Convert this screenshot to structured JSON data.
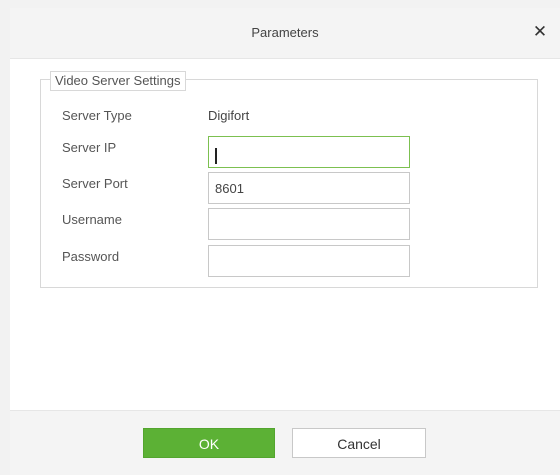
{
  "dialog": {
    "title": "Parameters",
    "close_glyph": "✕"
  },
  "fieldset": {
    "legend": "Video Server Settings"
  },
  "fields": {
    "server_type": {
      "label": "Server Type",
      "value": "Digifort"
    },
    "server_ip": {
      "label": "Server IP",
      "value": ""
    },
    "server_port": {
      "label": "Server Port",
      "value": "8601"
    },
    "username": {
      "label": "Username",
      "value": ""
    },
    "password": {
      "label": "Password",
      "value": ""
    }
  },
  "footer": {
    "ok_label": "OK",
    "cancel_label": "Cancel"
  },
  "colors": {
    "ok_button": "#5cb135",
    "focus_border": "#7cc050"
  }
}
